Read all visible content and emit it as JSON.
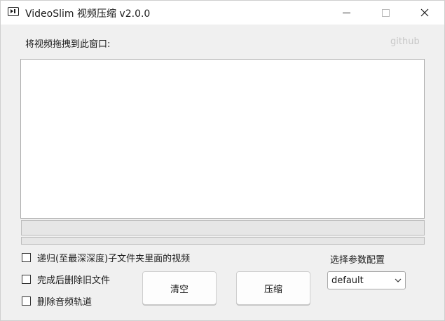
{
  "window": {
    "title": "VideoSlim 视频压缩 v2.0.0",
    "icon": "video-app-icon"
  },
  "main": {
    "drop_label": "将视频拖拽到此窗口:",
    "github_link": "github",
    "progress_percent": 0
  },
  "options": [
    {
      "label": "递归(至最深深度)子文件夹里面的视频",
      "checked": false
    },
    {
      "label": "完成后删除旧文件",
      "checked": false
    },
    {
      "label": "删除音频轨道",
      "checked": false
    }
  ],
  "buttons": {
    "clear_label": "清空",
    "compress_label": "压缩"
  },
  "preset": {
    "label": "选择参数配置",
    "selected": "default"
  }
}
